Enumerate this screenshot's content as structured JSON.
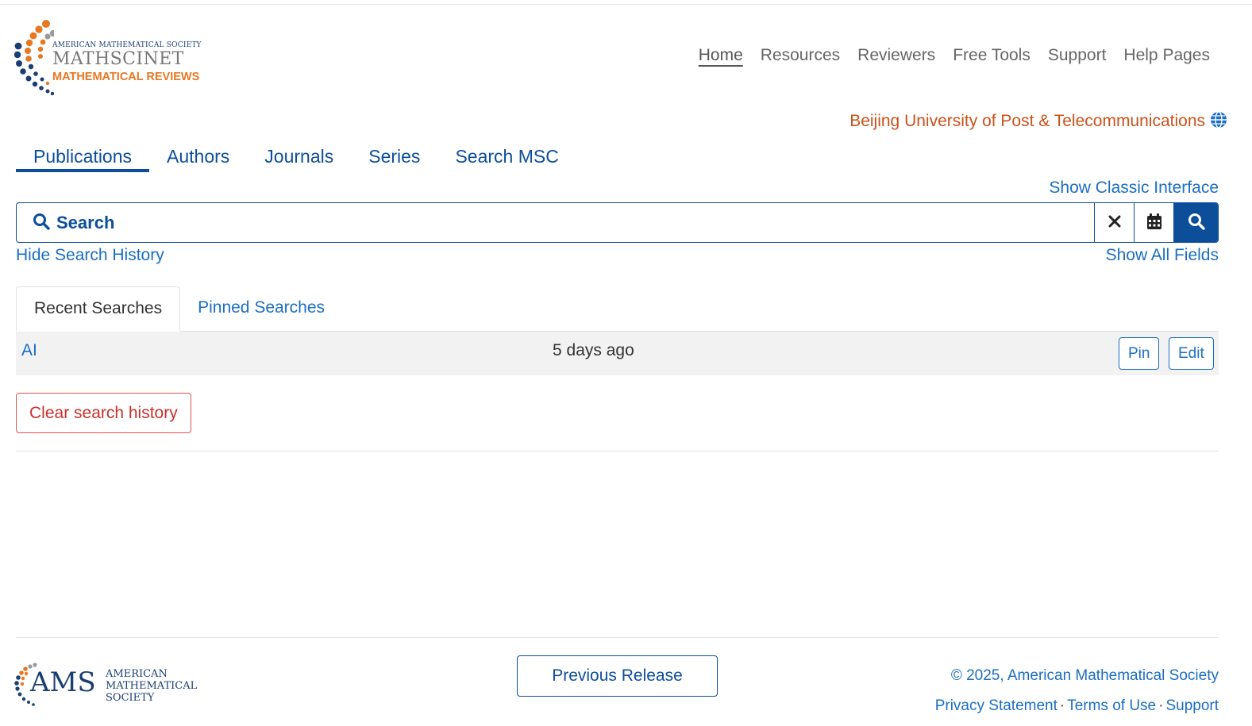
{
  "brand": {
    "society_line": "American Mathematical Society",
    "product_name": "MATHSCINET",
    "product_sub": "MATHEMATICAL REVIEWS",
    "dot_colors": [
      "#e87722",
      "#1a3e72",
      "#9a9a9a"
    ]
  },
  "topnav": {
    "items": [
      {
        "label": "Home",
        "active": true
      },
      {
        "label": "Resources"
      },
      {
        "label": "Reviewers"
      },
      {
        "label": "Free Tools"
      },
      {
        "label": "Support"
      },
      {
        "label": "Help Pages"
      }
    ]
  },
  "institution": {
    "name": "Beijing University of Post & Telecommunications",
    "icon": "globe-icon"
  },
  "tabs": [
    {
      "label": "Publications",
      "active": true
    },
    {
      "label": "Authors"
    },
    {
      "label": "Journals"
    },
    {
      "label": "Series"
    },
    {
      "label": "Search MSC"
    }
  ],
  "links": {
    "show_classic": "Show Classic Interface",
    "hide_history": "Hide Search History",
    "show_all_fields": "Show All Fields"
  },
  "search": {
    "placeholder": "Search",
    "value": "",
    "buttons": [
      "clear-icon",
      "calendar-icon",
      "search-icon"
    ]
  },
  "history": {
    "tabs": [
      {
        "label": "Recent Searches",
        "active": true
      },
      {
        "label": "Pinned Searches"
      }
    ],
    "rows": [
      {
        "query": "AI",
        "when": "5 days ago",
        "pin_label": "Pin",
        "edit_label": "Edit"
      }
    ],
    "clear_label": "Clear search history"
  },
  "footer": {
    "ams_big": "AMS",
    "ams_small": [
      "American",
      "Mathematical",
      "Society"
    ],
    "previous_release": "Previous Release",
    "copyright": "© 2025, American Mathematical Society",
    "links": [
      "Privacy Statement",
      "Terms of Use",
      "Support"
    ]
  },
  "colors": {
    "accent": "#0c4e9a",
    "link": "#1b6ec2",
    "institution": "#c9511a",
    "danger": "#c9302c",
    "row_bg": "#f2f2f2"
  }
}
